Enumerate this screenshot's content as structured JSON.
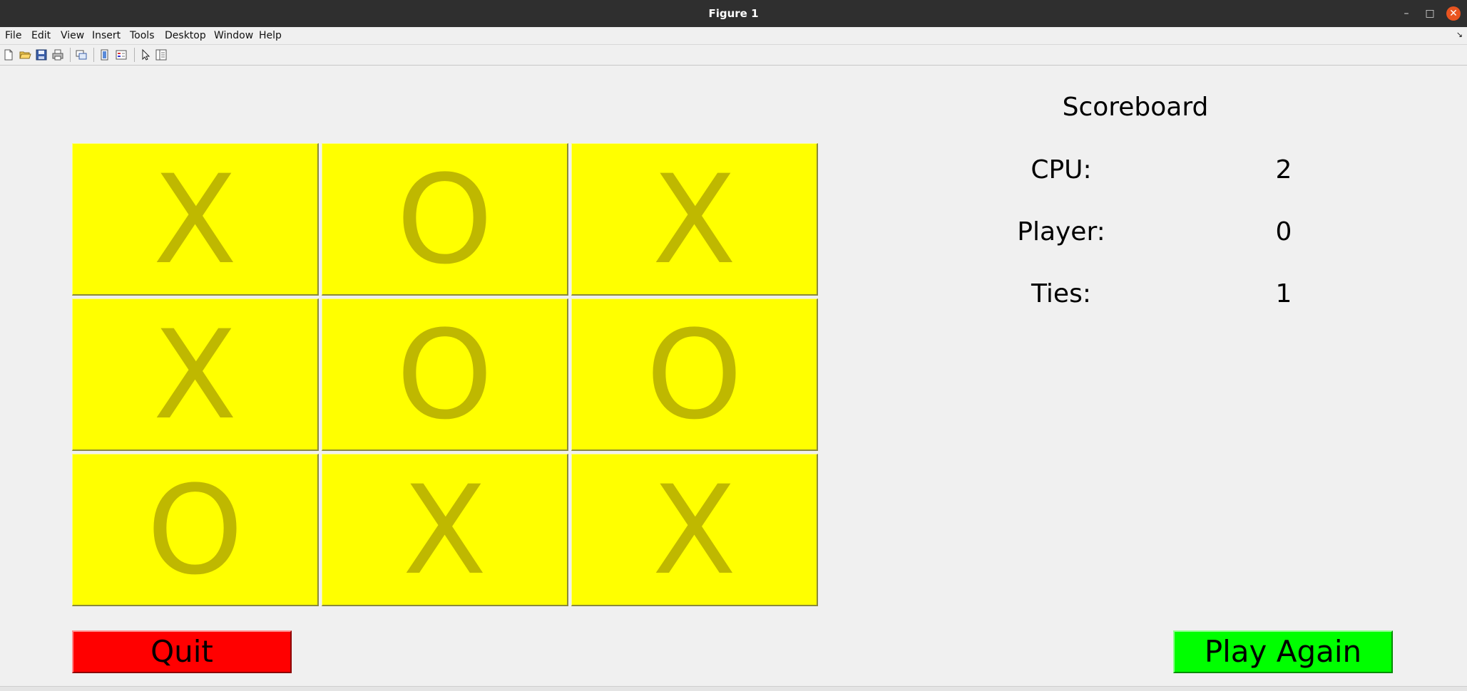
{
  "window": {
    "title": "Figure 1",
    "controls": {
      "minimize": "–",
      "maximize": "□",
      "close": "✕"
    }
  },
  "menubar": {
    "items": [
      "File",
      "Edit",
      "View",
      "Insert",
      "Tools",
      "Desktop",
      "Window",
      "Help"
    ]
  },
  "toolbar": {
    "icons": [
      "new-figure-icon",
      "open-file-icon",
      "save-icon",
      "print-icon",
      "link-plot-icon",
      "colorbar-icon",
      "legend-icon",
      "edit-plot-arrow-icon",
      "property-inspector-icon"
    ]
  },
  "board": {
    "cells": [
      "X",
      "O",
      "X",
      "X",
      "O",
      "O",
      "O",
      "X",
      "X"
    ],
    "cell_color": "#ffff00",
    "mark_color": "#bfb800"
  },
  "scoreboard": {
    "title": "Scoreboard",
    "rows": [
      {
        "label": "CPU:",
        "value": "2"
      },
      {
        "label": "Player:",
        "value": "0"
      },
      {
        "label": "Ties:",
        "value": "1"
      }
    ]
  },
  "buttons": {
    "quit": {
      "label": "Quit",
      "color": "#ff0000"
    },
    "play_again": {
      "label": "Play Again",
      "color": "#00ff00"
    }
  }
}
